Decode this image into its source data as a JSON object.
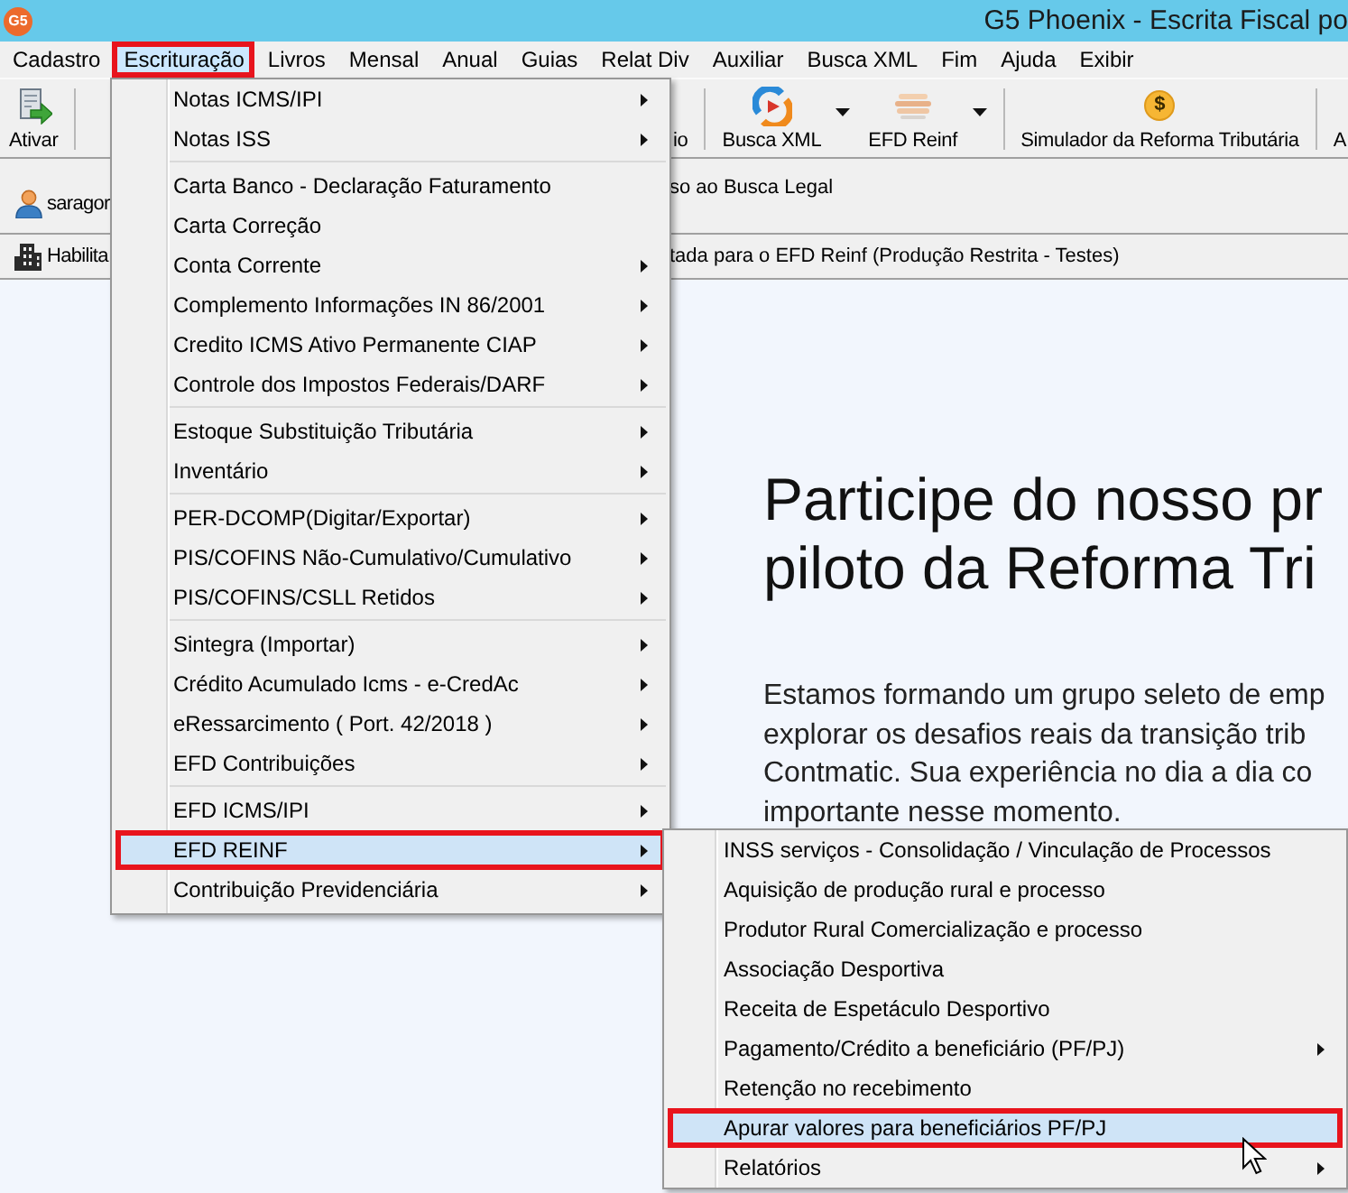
{
  "window": {
    "logo": "G5",
    "title": "G5 Phoenix - Escrita Fiscal po"
  },
  "menu_bar": [
    {
      "label": "Cadastro",
      "selected": false,
      "marked": false
    },
    {
      "label": "Escrituração",
      "selected": true,
      "marked": true
    },
    {
      "label": "Livros",
      "selected": false,
      "marked": false
    },
    {
      "label": "Mensal",
      "selected": false,
      "marked": false
    },
    {
      "label": "Anual",
      "selected": false,
      "marked": false
    },
    {
      "label": "Guias",
      "selected": false,
      "marked": false
    },
    {
      "label": "Relat Div",
      "selected": false,
      "marked": false
    },
    {
      "label": "Auxiliar",
      "selected": false,
      "marked": false
    },
    {
      "label": "Busca XML",
      "selected": false,
      "marked": false
    },
    {
      "label": "Fim",
      "selected": false,
      "marked": false
    },
    {
      "label": "Ajuda",
      "selected": false,
      "marked": false
    },
    {
      "label": "Exibir",
      "selected": false,
      "marked": false
    }
  ],
  "toolbar": {
    "left": [
      {
        "kind": "button",
        "label": "Ativar",
        "dropdown": false
      },
      {
        "kind": "separator"
      }
    ],
    "right": [
      {
        "kind": "button",
        "label": "io",
        "dropdown": false
      },
      {
        "kind": "separator"
      },
      {
        "kind": "button",
        "label": "Busca XML",
        "dropdown": true
      },
      {
        "kind": "button",
        "label": "EFD Reinf",
        "dropdown": true
      },
      {
        "kind": "separator"
      },
      {
        "kind": "button",
        "label": "Simulador da Reforma Tributária",
        "dropdown": false,
        "icon_text": "$"
      },
      {
        "kind": "separator"
      },
      {
        "kind": "button",
        "label": "A",
        "dropdown": false
      }
    ]
  },
  "info_rows": [
    {
      "left": "saragor",
      "right": "so ao Busca Legal"
    },
    {
      "left": "Habilita",
      "right": "tada para o EFD Reinf (Produção Restrita - Testes)"
    }
  ],
  "content": {
    "heading_lines": [
      "Participe do nosso pr",
      "piloto da Reforma Tri"
    ],
    "paragraph_lines": [
      "Estamos formando um grupo seleto de emp",
      "explorar os desafios reais da transição trib",
      "Contmatic. Sua experiência no dia a dia co",
      "importante nesse momento."
    ]
  },
  "menu": [
    {
      "kind": "item",
      "label": "Notas ICMS/IPI",
      "has_submenu": true,
      "selected": false,
      "marked": false
    },
    {
      "kind": "item",
      "label": "Notas ISS",
      "has_submenu": true,
      "selected": false,
      "marked": false
    },
    {
      "kind": "separator"
    },
    {
      "kind": "item",
      "label": "Carta Banco - Declaração Faturamento",
      "has_submenu": false,
      "selected": false,
      "marked": false
    },
    {
      "kind": "item",
      "label": "Carta Correção",
      "has_submenu": false,
      "selected": false,
      "marked": false
    },
    {
      "kind": "item",
      "label": "Conta Corrente",
      "has_submenu": true,
      "selected": false,
      "marked": false
    },
    {
      "kind": "item",
      "label": "Complemento Informações IN 86/2001",
      "has_submenu": true,
      "selected": false,
      "marked": false
    },
    {
      "kind": "item",
      "label": "Credito ICMS Ativo Permanente CIAP",
      "has_submenu": true,
      "selected": false,
      "marked": false
    },
    {
      "kind": "item",
      "label": "Controle dos Impostos Federais/DARF",
      "has_submenu": true,
      "selected": false,
      "marked": false
    },
    {
      "kind": "separator"
    },
    {
      "kind": "item",
      "label": "Estoque Substituição Tributária",
      "has_submenu": true,
      "selected": false,
      "marked": false
    },
    {
      "kind": "item",
      "label": "Inventário",
      "has_submenu": true,
      "selected": false,
      "marked": false
    },
    {
      "kind": "separator"
    },
    {
      "kind": "item",
      "label": "PER-DCOMP(Digitar/Exportar)",
      "has_submenu": true,
      "selected": false,
      "marked": false
    },
    {
      "kind": "item",
      "label": "PIS/COFINS Não-Cumulativo/Cumulativo",
      "has_submenu": true,
      "selected": false,
      "marked": false
    },
    {
      "kind": "item",
      "label": "PIS/COFINS/CSLL Retidos",
      "has_submenu": true,
      "selected": false,
      "marked": false
    },
    {
      "kind": "separator"
    },
    {
      "kind": "item",
      "label": "Sintegra (Importar)",
      "has_submenu": true,
      "selected": false,
      "marked": false
    },
    {
      "kind": "item",
      "label": "Crédito Acumulado Icms - e-CredAc",
      "has_submenu": true,
      "selected": false,
      "marked": false
    },
    {
      "kind": "item",
      "label": "eRessarcimento ( Port. 42/2018 )",
      "has_submenu": true,
      "selected": false,
      "marked": false
    },
    {
      "kind": "item",
      "label": "EFD Contribuições",
      "has_submenu": true,
      "selected": false,
      "marked": false
    },
    {
      "kind": "separator"
    },
    {
      "kind": "item",
      "label": "EFD ICMS/IPI",
      "has_submenu": true,
      "selected": false,
      "marked": false
    },
    {
      "kind": "item",
      "label": "EFD REINF",
      "has_submenu": true,
      "selected": true,
      "marked": true
    },
    {
      "kind": "item",
      "label": "Contribuição Previdenciária",
      "has_submenu": true,
      "selected": false,
      "marked": false
    }
  ],
  "submenu": [
    {
      "kind": "item",
      "label": "INSS serviços - Consolidação / Vinculação de Processos",
      "has_submenu": false,
      "selected": false,
      "marked": false
    },
    {
      "kind": "item",
      "label": "Aquisição de produção rural e processo",
      "has_submenu": false,
      "selected": false,
      "marked": false
    },
    {
      "kind": "item",
      "label": "Produtor Rural Comercialização e processo",
      "has_submenu": false,
      "selected": false,
      "marked": false
    },
    {
      "kind": "item",
      "label": "Associação Desportiva",
      "has_submenu": false,
      "selected": false,
      "marked": false
    },
    {
      "kind": "item",
      "label": "Receita de Espetáculo Desportivo",
      "has_submenu": false,
      "selected": false,
      "marked": false
    },
    {
      "kind": "item",
      "label": "Pagamento/Crédito a beneficiário (PF/PJ)",
      "has_submenu": true,
      "selected": false,
      "marked": false
    },
    {
      "kind": "item",
      "label": "Retenção no recebimento",
      "has_submenu": false,
      "selected": false,
      "marked": false
    },
    {
      "kind": "item",
      "label": "Apurar valores para beneficiários PF/PJ",
      "has_submenu": false,
      "selected": true,
      "marked": true
    },
    {
      "kind": "item",
      "label": "Relatórios",
      "has_submenu": true,
      "selected": false,
      "marked": false
    }
  ]
}
